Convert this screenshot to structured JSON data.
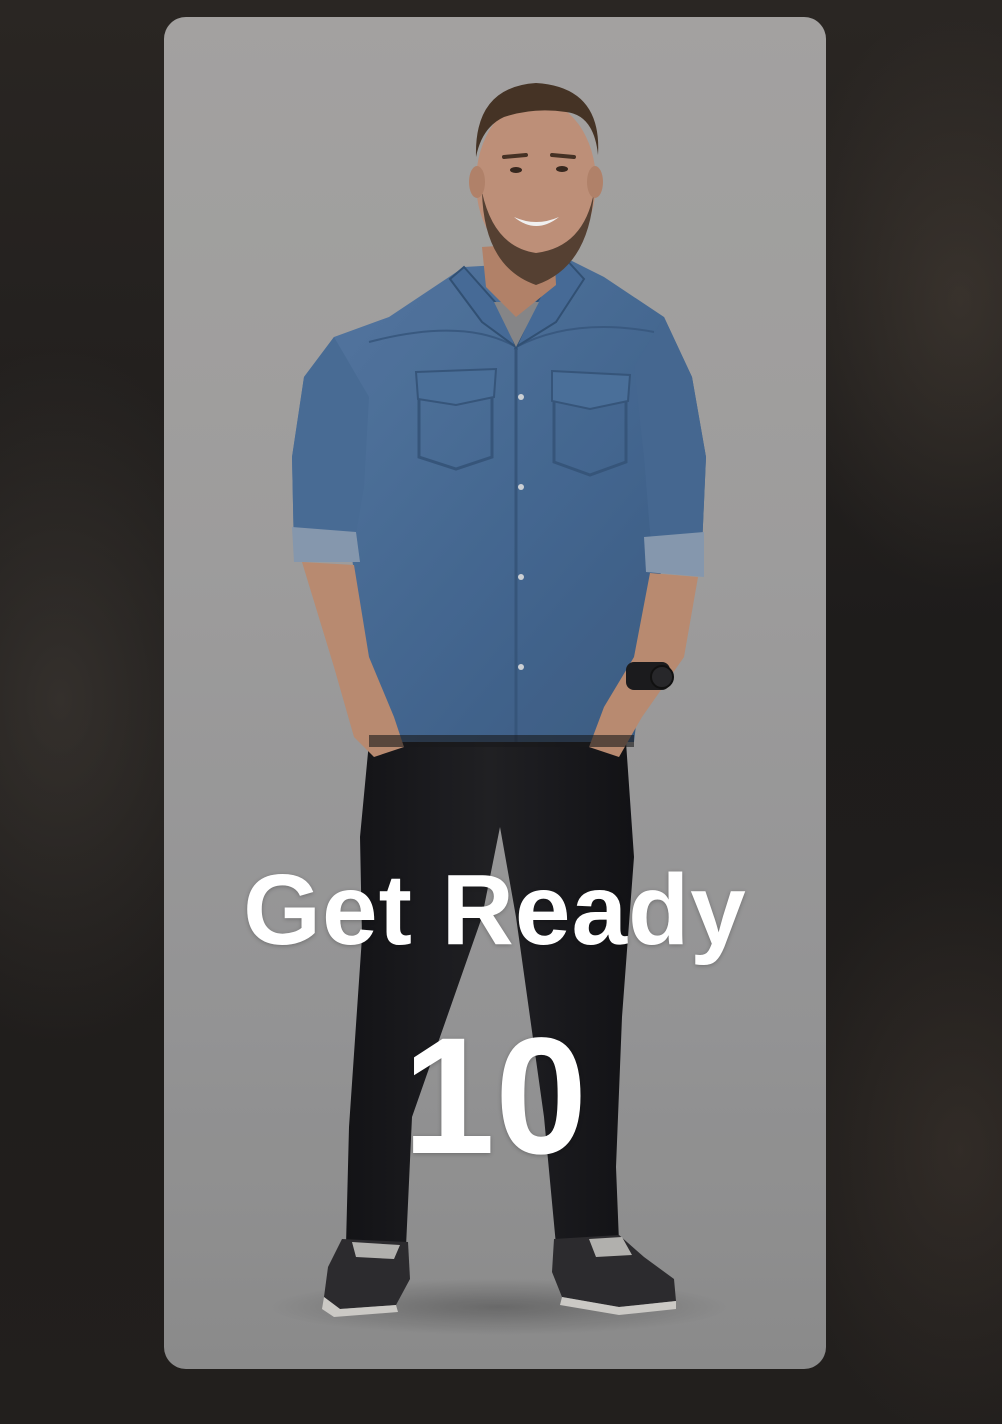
{
  "overlay": {
    "title": "Get Ready",
    "countdown": "10"
  },
  "media": {
    "subject": "standing-man-photo"
  },
  "colors": {
    "text": "#ffffff",
    "card_background": "#a6a5a5",
    "screen_background": "#1e1c1b",
    "shirt": "#4a6f9b",
    "jeans": "#1c1c1f"
  }
}
